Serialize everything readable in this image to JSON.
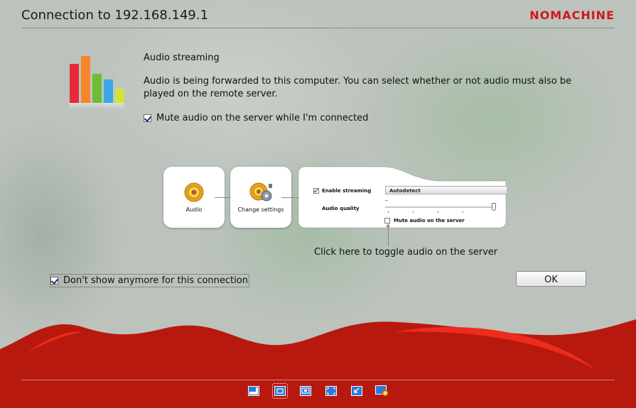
{
  "header": {
    "title": "Connection to 192.168.149.1",
    "brand": "NOMACHINE"
  },
  "content": {
    "heading": "Audio streaming",
    "description": "Audio is being forwarded to this computer. You can select whether or not audio must also be played on the remote server.",
    "mute_checkbox": {
      "label": "Mute audio on the server while I'm connected",
      "checked": true
    }
  },
  "diagram": {
    "step1_label": "Audio",
    "step2_label": "Change settings",
    "enable_streaming": {
      "label": "Enable streaming",
      "checked": true
    },
    "audio_quality_label": "Audio quality",
    "quality_select_value": "Autodetect",
    "quality_level": 1.0,
    "mute_on_server": {
      "label": "Mute audio on the server",
      "checked": false
    },
    "hint": "Click here to toggle audio on the server"
  },
  "footer": {
    "dont_show": {
      "label": "Don't show anymore for this connection",
      "checked": true
    },
    "ok_label": "OK"
  },
  "toolbar": {
    "icons": [
      "window-mode-icon",
      "fit-display-icon",
      "resize-remote-display-icon",
      "fullscreen-icon",
      "scale-display-icon",
      "display-settings-icon"
    ],
    "selected_index": 1
  },
  "colors": {
    "brand": "#d0161c",
    "wave": "#bb1a10",
    "wave_highlight": "#ef2a1c"
  }
}
